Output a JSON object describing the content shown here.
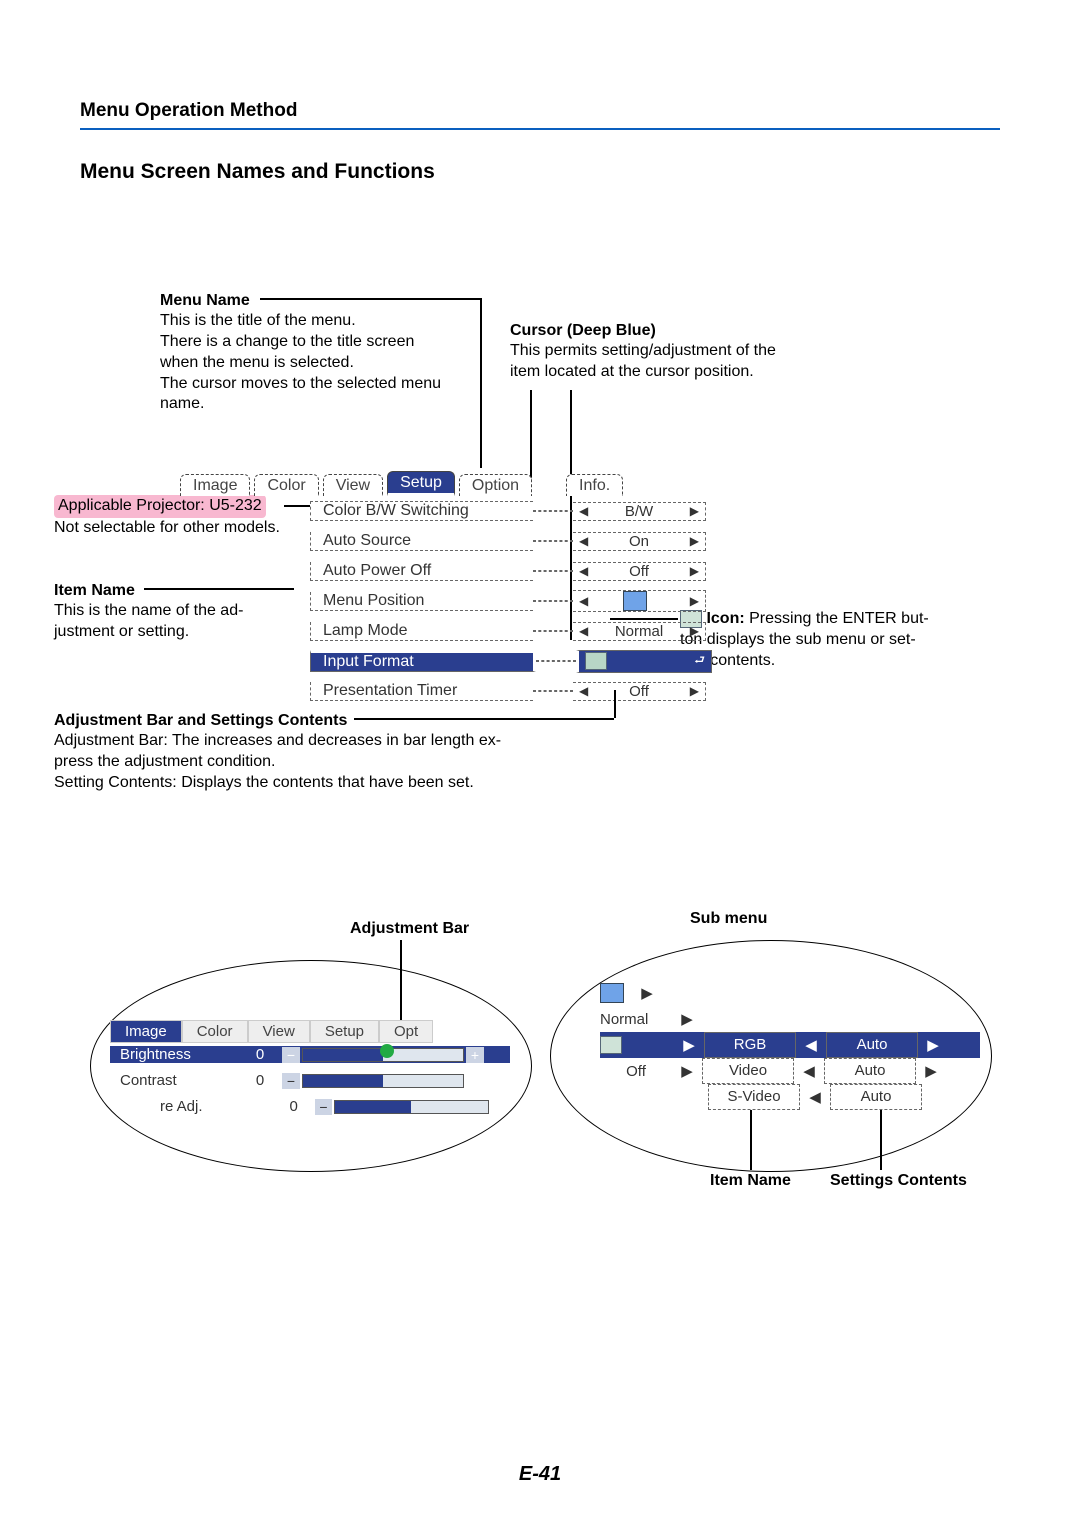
{
  "header": "Menu Operation Method",
  "title": "Menu Screen Names and Functions",
  "page_number": "E-41",
  "annot": {
    "menu_name": {
      "head": "Menu Name",
      "l1": "This is the title of the menu.",
      "l2": "There is a change to the title screen",
      "l3": "when the menu is selected.",
      "l4": "The cursor moves to the selected menu",
      "l5": "name."
    },
    "cursor": {
      "head": "Cursor (Deep Blue)",
      "l1": "This permits setting/adjustment of the",
      "l2": "item located at the cursor position."
    },
    "applicable": {
      "l1": "Applicable Projector: U5-232",
      "l2": "Not selectable for other models."
    },
    "item_name": {
      "head": "Item Name",
      "l1": "This is the name of the ad-",
      "l2": "justment or setting."
    },
    "icon": {
      "head": "Icon:",
      "l1": "Pressing the ENTER but-",
      "l2": "ton displays the sub menu or set-",
      "l3": "ting contents."
    },
    "adjbar": {
      "head": "Adjustment Bar and Settings Contents",
      "l1": "Adjustment Bar: The increases and decreases in bar length ex-",
      "l2": "press the adjustment condition.",
      "l3": "Setting Contents: Displays the contents that have been set."
    }
  },
  "menu": {
    "tabs": [
      "Image",
      "Color",
      "View",
      "Setup",
      "Option",
      "Info."
    ],
    "items": [
      {
        "name": "Color B/W Switching",
        "value": "B/W"
      },
      {
        "name": "Auto Source",
        "value": "On"
      },
      {
        "name": "Auto Power Off",
        "value": "Off"
      },
      {
        "name": "Menu Position",
        "value": ""
      },
      {
        "name": "Lamp Mode",
        "value": "Normal"
      },
      {
        "name": "Input Format",
        "value": ""
      },
      {
        "name": "Presentation Timer",
        "value": "Off"
      }
    ]
  },
  "adjfig": {
    "tabs": [
      "Image",
      "Color",
      "View",
      "Setup",
      "Opt"
    ],
    "rows": [
      {
        "name": "Brightness",
        "val": "0"
      },
      {
        "name": "Contrast",
        "val": "0"
      },
      {
        "name": "re Adj.",
        "val": "0"
      }
    ]
  },
  "subfig": {
    "left": [
      "Normal",
      "Off"
    ],
    "mid": [
      "RGB",
      "Video",
      "S-Video"
    ],
    "right": [
      "Auto",
      "Auto",
      "Auto"
    ]
  },
  "labels": {
    "adj_bar": "Adjustment Bar",
    "sub_menu": "Sub menu",
    "item_name": "Item Name",
    "settings_contents": "Settings Contents"
  }
}
